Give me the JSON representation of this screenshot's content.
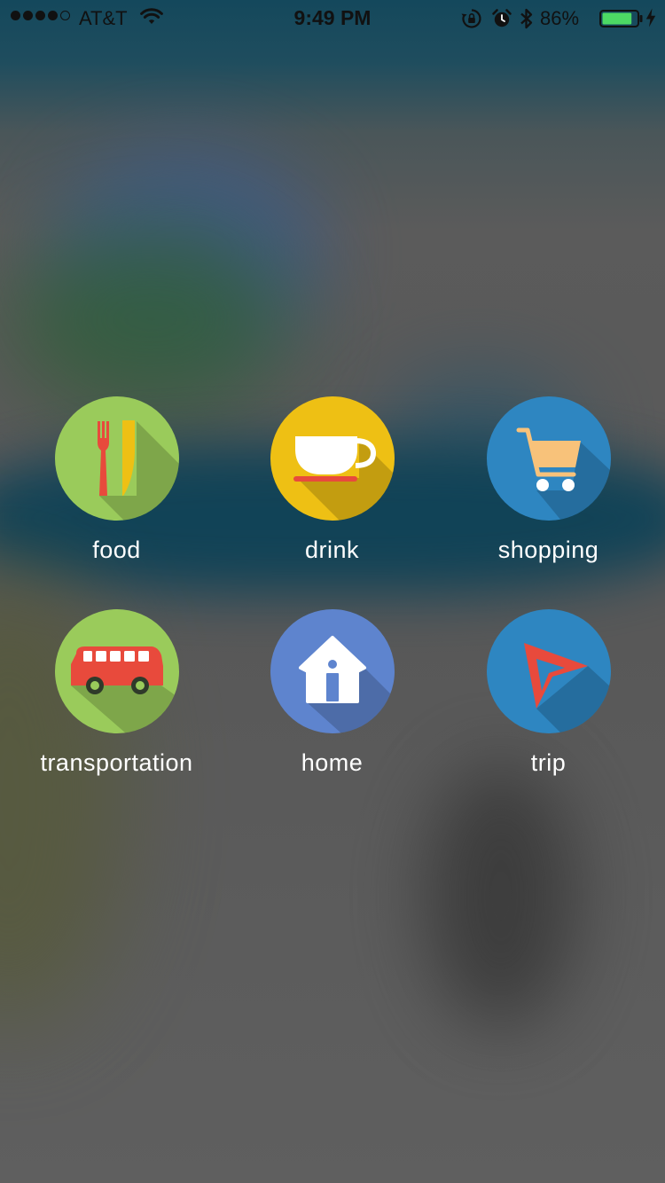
{
  "status_bar": {
    "carrier": "AT&T",
    "time": "9:49 PM",
    "battery_percent": "86%",
    "battery_level": 0.86,
    "signal_bars_filled": 4,
    "signal_bars_total": 5
  },
  "categories": [
    {
      "label": "food",
      "icon": "fork-knife-icon",
      "circle_color": "#9acb5b"
    },
    {
      "label": "drink",
      "icon": "coffee-cup-icon",
      "circle_color": "#eec014"
    },
    {
      "label": "shopping",
      "icon": "shopping-cart-icon",
      "circle_color": "#2e86c1"
    },
    {
      "label": "transportation",
      "icon": "bus-icon",
      "circle_color": "#9acb5b"
    },
    {
      "label": "home",
      "icon": "house-icon",
      "circle_color": "#5e84ce"
    },
    {
      "label": "trip",
      "icon": "navigation-arrow-icon",
      "circle_color": "#2e86c1"
    }
  ]
}
